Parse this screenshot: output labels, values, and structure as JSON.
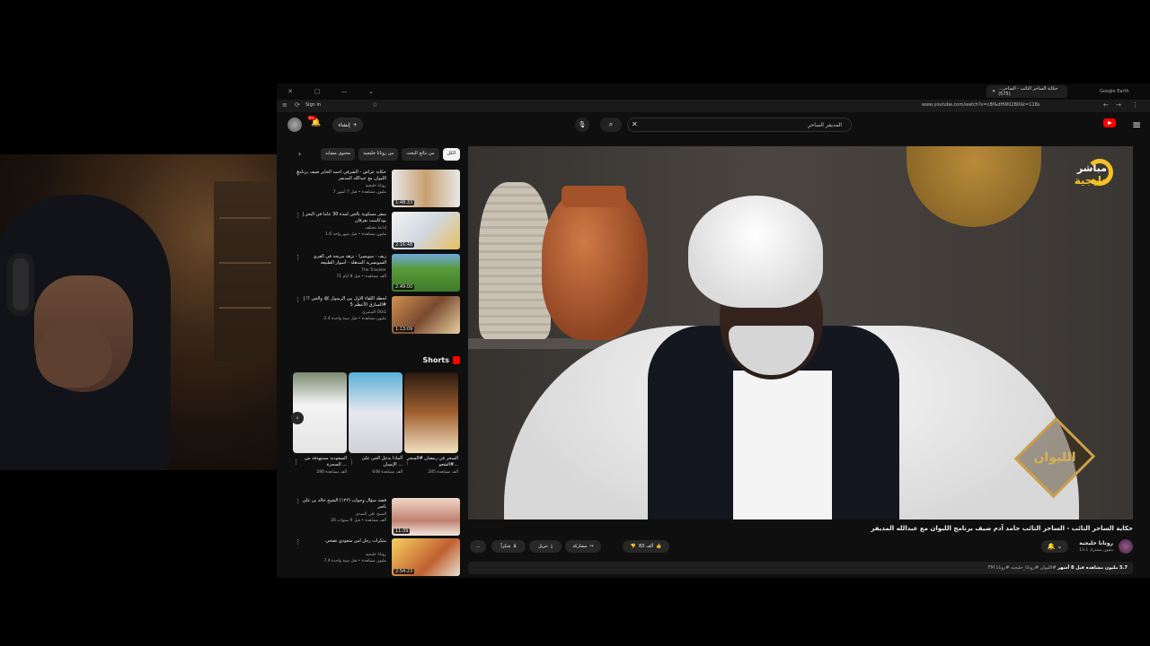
{
  "browser": {
    "tab_active_title": "حكاية الساحر التائب - الساحر... (575)",
    "tab_other_title": "Google Earth",
    "sign_in": "Sign in",
    "url": "www.youtube.com/watch?v=c8f&dHW02B0&t=118s"
  },
  "header": {
    "search_value": "المديفر الساحر",
    "create_label": "إنشاء",
    "notif_count": "9+"
  },
  "chips": [
    "الكل",
    "من نتائج البحث",
    "من روتانا خليجية",
    "محتوى مشابه"
  ],
  "recs": [
    {
      "title": "حكاية عراض - الشرفي أحمد الجابر ضيف برنامج الليوان مع عبدالله المديفر",
      "channel": "روتانا خليجية",
      "meta": "7 مليون مشاهدة • قبل 7 أشهر",
      "duration": "1:48:33"
    },
    {
      "title": "سفر مسكونة بالجن لمدة 30 عاماً في البحر | بودكاست بفرقان",
      "channel": "إذاعة مختلف",
      "meta": "1.6 مليون مشاهدة • قبل شهر واحد",
      "duration": "2:16:48"
    },
    {
      "title": "زيف - سويسرا - نزهة مريحة في القرى السويسرية المذهلة - أسوار الطبيعة",
      "channel": "The Traveler",
      "meta": "71 ألف مشاهدة • قبل 8 أيام",
      "duration": "2:49:00"
    },
    {
      "title": "لحظة اللقاء الأول بين الرسول ﷺ والجن !! | السارق الأعظم 5#",
      "channel": "المصري OGG",
      "meta": "2.4 مليون مشاهدة • قبل سنة واحدة",
      "duration": "1:13:09"
    }
  ],
  "shorts": {
    "heading": "Shorts",
    "items": [
      {
        "title": "السحر في رمضان #السحر #الشعو...",
        "views": "285 ألف مشاهدة"
      },
      {
        "title": "ألماذا يدخل الجن على الإنسان ...",
        "views": "648 ألف مشاهدة"
      },
      {
        "title": "السعودية مستهدفة من السحرة ...",
        "views": "280 ألف مشاهدة"
      }
    ]
  },
  "recs2": [
    {
      "title": "قصة سؤال وجواب (١٢٢) الشيخ خالد بن علي ناصر",
      "channel": "الشيخ علي الشدي",
      "meta": "26 ألف مشاهدة • قبل 9 سنوات",
      "duration": "11:39"
    },
    {
      "title": "متكرات رجل أمن سعودي تضحي",
      "channel": "روتانا خليجية",
      "meta": "7.4 مليون مشاهدة • قبل سنة واحدة",
      "duration": "2:54:23"
    }
  ],
  "player": {
    "live_label": "مباشر",
    "channel_name": "خليجية",
    "show_logo": "الليوان"
  },
  "video": {
    "title": "حكاية الساحر التائب - الساحر التائب حامد آدم ضيف برنامج الليوان مع عبدالله المديفر",
    "channel": "روتانا خليجية",
    "subs": "13.1 مليون مشترك",
    "likes": "83 ألف",
    "share": "مشاركة",
    "download": "تنزيل",
    "thanks": "شكراً",
    "views_line": "5.7 مليون مشاهدة قبل 8 أشهر",
    "tags": "#الليوان #روتانا_خليجية #روتانا FM"
  },
  "colors": {
    "accent": "#ff0000",
    "gold": "#f4c222",
    "bg": "#0f0f0f"
  }
}
